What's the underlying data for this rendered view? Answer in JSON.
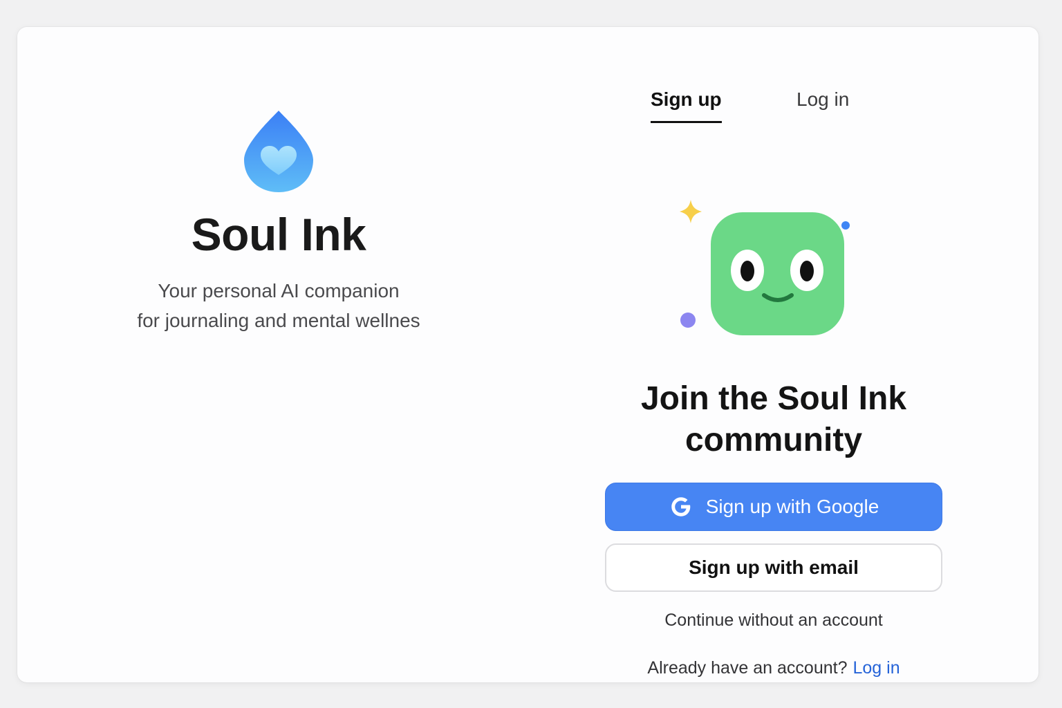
{
  "brand": {
    "logo_icon": "water-drop-heart-icon",
    "name": "Soul Ink",
    "tagline_line1": "Your personal AI companion",
    "tagline_line2": "for journaling and mental wellnes"
  },
  "tabs": [
    {
      "label": "Sign up",
      "active": true
    },
    {
      "label": "Log in",
      "active": false
    }
  ],
  "illustration": {
    "mascot": "smiling-green-square-mascot-icon",
    "decorations": [
      "sparkle-icon",
      "dot-icon"
    ]
  },
  "signup": {
    "headline_line1": "Join the Soul Ink",
    "headline_line2": "community",
    "google_button_label": "Sign up with Google",
    "email_button_label": "Sign up with email",
    "continue_label": "Continue without an account",
    "already_text": "Already have an account?",
    "login_link_label": "Log in"
  },
  "colors": {
    "accent": "#4785f3",
    "link": "#2563d8",
    "mascot_green": "#6bd887",
    "logo_blue": "#3f86f5"
  }
}
